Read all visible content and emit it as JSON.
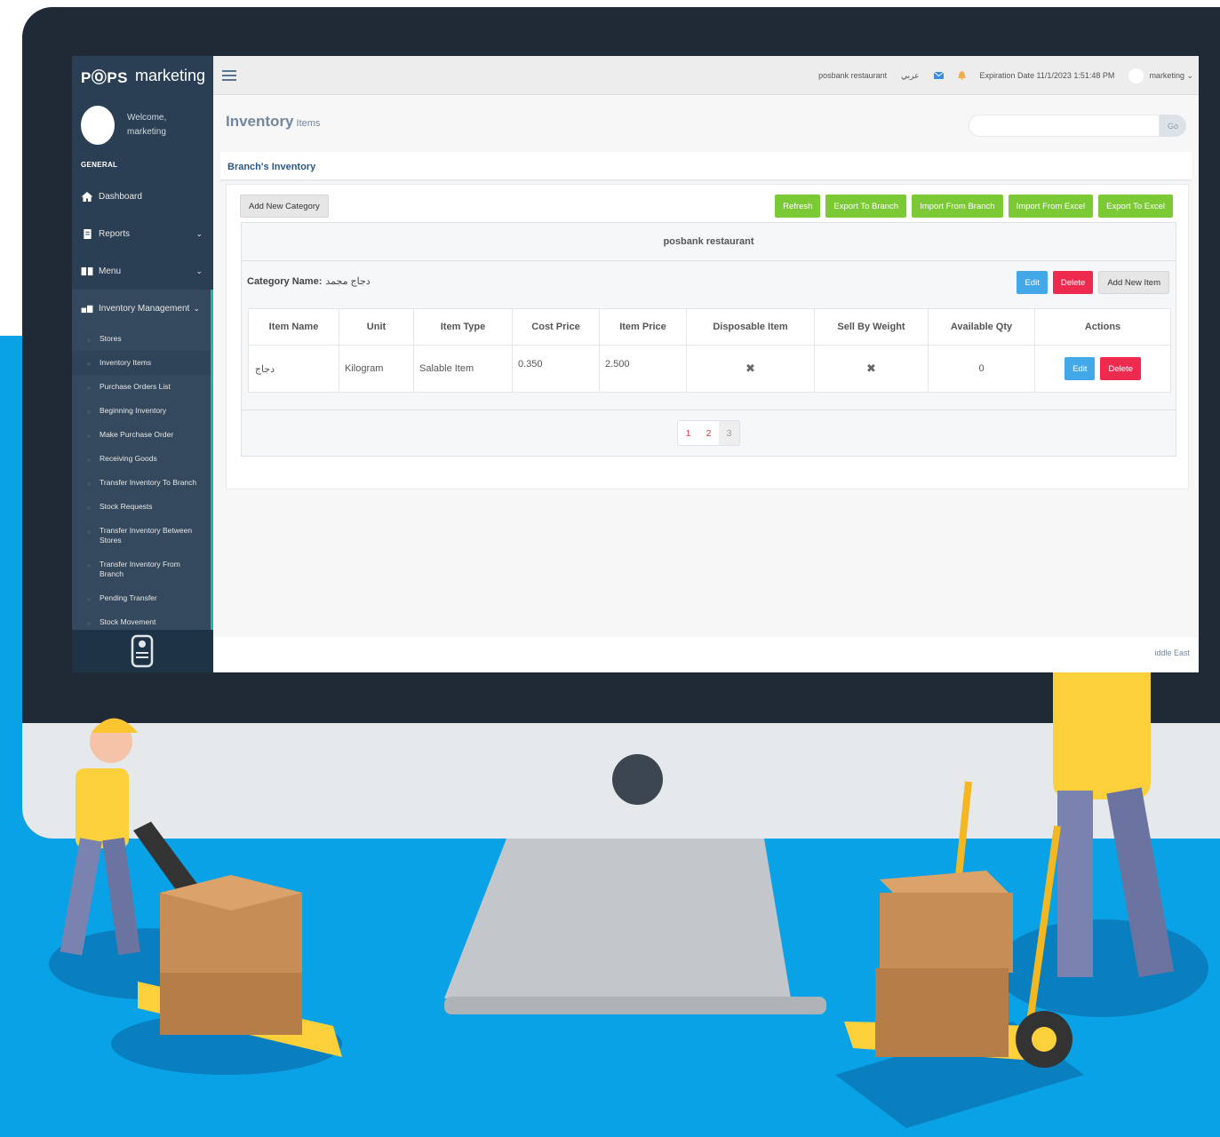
{
  "sidebar": {
    "brand_logo": "PⓄPS",
    "brand_name": "marketing",
    "welcome": "Welcome,",
    "username": "marketing",
    "section": "GENERAL",
    "nav": [
      {
        "label": "Dashboard"
      },
      {
        "label": "Reports"
      },
      {
        "label": "Menu"
      },
      {
        "label": "Inventory Management"
      }
    ],
    "sub_items": [
      "Stores",
      "Inventory Items",
      "Purchase Orders List",
      "Beginning Inventory",
      "Make Purchase Order",
      "Receiving Goods",
      "Transfer Inventory To Branch",
      "Stock Requests",
      "Transfer Inventory Between Stores",
      "Transfer Inventory From Branch",
      "Pending Transfer",
      "Stock Movement"
    ]
  },
  "topnav": {
    "restaurant": "posbank restaurant",
    "language": "عربي",
    "expiration": "Expiration Date 11/1/2023 1:51:48 PM",
    "user": "marketing"
  },
  "page": {
    "title": "Inventory",
    "subtitle": "Items",
    "search_button": "Go",
    "panel_title": "Branch's Inventory"
  },
  "toolbar": {
    "add_category": "Add New Category",
    "refresh": "Refresh",
    "export_branch": "Export To Branch",
    "import_branch": "Import From Branch",
    "import_excel": "Import From Excel",
    "export_excel": "Export To Excel"
  },
  "restaurant_name": "posbank restaurant",
  "category": {
    "label": "Category Name:",
    "name": "دجاج مجمد",
    "edit": "Edit",
    "delete": "Delete",
    "add_item": "Add New Item"
  },
  "table": {
    "headers": [
      "Item Name",
      "Unit",
      "Item Type",
      "Cost Price",
      "Item Price",
      "Disposable Item",
      "Sell By Weight",
      "Available Qty",
      "Actions"
    ],
    "rows": [
      {
        "name": "دجاج",
        "unit": "Kilogram",
        "type": "Salable Item",
        "cost": "0.350",
        "price": "2.500",
        "disposable": "✖",
        "by_weight": "✖",
        "qty": "0",
        "edit": "Edit",
        "delete": "Delete"
      }
    ]
  },
  "pagination": [
    "1",
    "2",
    "3"
  ],
  "footer": "iddle East",
  "colors": {
    "sidebar": "#2a3f54",
    "accent_green": "#7bc935",
    "accent_blue": "#42a8e8",
    "accent_red": "#ef2a4f",
    "background_blue": "#0aa2e6"
  }
}
